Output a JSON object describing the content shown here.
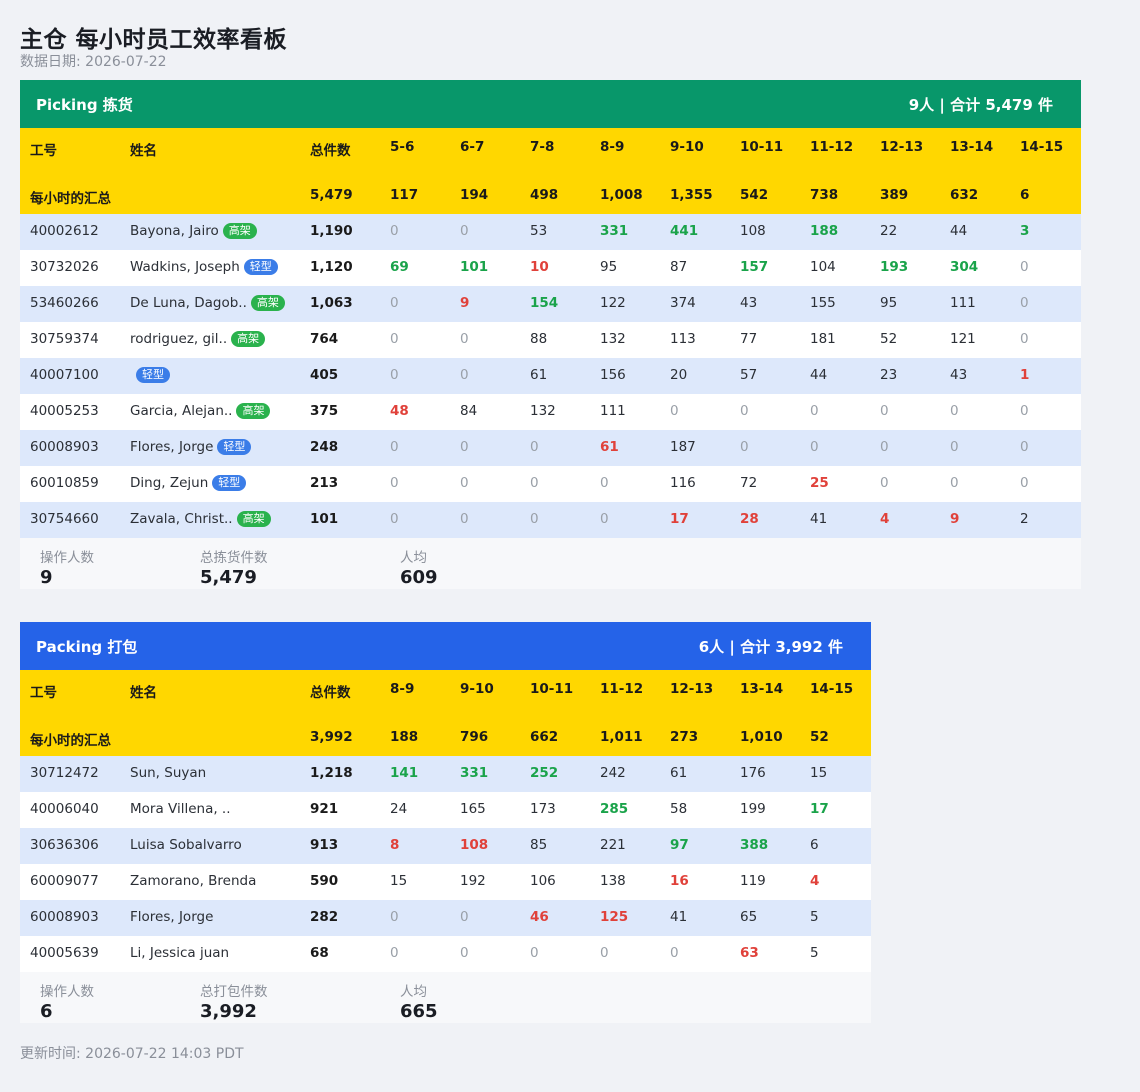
{
  "page": {
    "title": "主仓 每小时员工效率看板",
    "date_line": "数据日期: 2026-07-22",
    "footer": "更新时间: 2026-07-22 14:03 PDT"
  },
  "colors": {
    "picking_header": "#08976a",
    "packing_header": "#2563e8",
    "column_header_bg": "#ffd700",
    "high_value": "#1aa34a",
    "low_value": "#e0413a",
    "badge_gaojia": "#2ab24d",
    "badge_qingxing": "#3b7de8"
  },
  "sections": [
    {
      "key": "picking",
      "title": "Picking 拣货",
      "summary_right": "9人 | 合计 5,479 件",
      "columns": [
        "工号",
        "姓名",
        "总件数",
        "5-6",
        "6-7",
        "7-8",
        "8-9",
        "9-10",
        "10-11",
        "11-12",
        "12-13",
        "13-14",
        "14-15"
      ],
      "hourly_label": "每小时的汇总",
      "hourly_total": "5,479",
      "hourly": [
        "117",
        "194",
        "498",
        "1,008",
        "1,355",
        "542",
        "738",
        "389",
        "632",
        "6"
      ],
      "rows": [
        {
          "id": "40002612",
          "name": "Bayona, Jairo",
          "badge": "高架",
          "badge_type": "g",
          "total": "1,190",
          "values": [
            {
              "v": "0",
              "s": "zero"
            },
            {
              "v": "0",
              "s": "zero"
            },
            {
              "v": "53",
              "s": "norm"
            },
            {
              "v": "331",
              "s": "hi"
            },
            {
              "v": "441",
              "s": "hi"
            },
            {
              "v": "108",
              "s": "norm"
            },
            {
              "v": "188",
              "s": "hi"
            },
            {
              "v": "22",
              "s": "norm"
            },
            {
              "v": "44",
              "s": "norm"
            },
            {
              "v": "3",
              "s": "hi"
            }
          ]
        },
        {
          "id": "30732026",
          "name": "Wadkins, Joseph",
          "badge": "轻型",
          "badge_type": "b",
          "total": "1,120",
          "values": [
            {
              "v": "69",
              "s": "hi"
            },
            {
              "v": "101",
              "s": "hi"
            },
            {
              "v": "10",
              "s": "lo"
            },
            {
              "v": "95",
              "s": "norm"
            },
            {
              "v": "87",
              "s": "norm"
            },
            {
              "v": "157",
              "s": "hi"
            },
            {
              "v": "104",
              "s": "norm"
            },
            {
              "v": "193",
              "s": "hi"
            },
            {
              "v": "304",
              "s": "hi"
            },
            {
              "v": "0",
              "s": "zero"
            }
          ]
        },
        {
          "id": "53460266",
          "name": "De Luna, Dagob..",
          "badge": "高架",
          "badge_type": "g",
          "total": "1,063",
          "values": [
            {
              "v": "0",
              "s": "zero"
            },
            {
              "v": "9",
              "s": "lo"
            },
            {
              "v": "154",
              "s": "hi"
            },
            {
              "v": "122",
              "s": "norm"
            },
            {
              "v": "374",
              "s": "norm"
            },
            {
              "v": "43",
              "s": "norm"
            },
            {
              "v": "155",
              "s": "norm"
            },
            {
              "v": "95",
              "s": "norm"
            },
            {
              "v": "111",
              "s": "norm"
            },
            {
              "v": "0",
              "s": "zero"
            }
          ]
        },
        {
          "id": "30759374",
          "name": "rodriguez, gil..",
          "badge": "高架",
          "badge_type": "g",
          "total": "764",
          "values": [
            {
              "v": "0",
              "s": "zero"
            },
            {
              "v": "0",
              "s": "zero"
            },
            {
              "v": "88",
              "s": "norm"
            },
            {
              "v": "132",
              "s": "norm"
            },
            {
              "v": "113",
              "s": "norm"
            },
            {
              "v": "77",
              "s": "norm"
            },
            {
              "v": "181",
              "s": "norm"
            },
            {
              "v": "52",
              "s": "norm"
            },
            {
              "v": "121",
              "s": "norm"
            },
            {
              "v": "0",
              "s": "zero"
            }
          ]
        },
        {
          "id": "40007100",
          "name": "",
          "badge": "轻型",
          "badge_type": "b",
          "total": "405",
          "values": [
            {
              "v": "0",
              "s": "zero"
            },
            {
              "v": "0",
              "s": "zero"
            },
            {
              "v": "61",
              "s": "norm"
            },
            {
              "v": "156",
              "s": "norm"
            },
            {
              "v": "20",
              "s": "norm"
            },
            {
              "v": "57",
              "s": "norm"
            },
            {
              "v": "44",
              "s": "norm"
            },
            {
              "v": "23",
              "s": "norm"
            },
            {
              "v": "43",
              "s": "norm"
            },
            {
              "v": "1",
              "s": "lo"
            }
          ]
        },
        {
          "id": "40005253",
          "name": "Garcia, Alejan..",
          "badge": "高架",
          "badge_type": "g",
          "total": "375",
          "values": [
            {
              "v": "48",
              "s": "lo"
            },
            {
              "v": "84",
              "s": "norm"
            },
            {
              "v": "132",
              "s": "norm"
            },
            {
              "v": "111",
              "s": "norm"
            },
            {
              "v": "0",
              "s": "zero"
            },
            {
              "v": "0",
              "s": "zero"
            },
            {
              "v": "0",
              "s": "zero"
            },
            {
              "v": "0",
              "s": "zero"
            },
            {
              "v": "0",
              "s": "zero"
            },
            {
              "v": "0",
              "s": "zero"
            }
          ]
        },
        {
          "id": "60008903",
          "name": "Flores, Jorge",
          "badge": "轻型",
          "badge_type": "b",
          "total": "248",
          "values": [
            {
              "v": "0",
              "s": "zero"
            },
            {
              "v": "0",
              "s": "zero"
            },
            {
              "v": "0",
              "s": "zero"
            },
            {
              "v": "61",
              "s": "lo"
            },
            {
              "v": "187",
              "s": "norm"
            },
            {
              "v": "0",
              "s": "zero"
            },
            {
              "v": "0",
              "s": "zero"
            },
            {
              "v": "0",
              "s": "zero"
            },
            {
              "v": "0",
              "s": "zero"
            },
            {
              "v": "0",
              "s": "zero"
            }
          ]
        },
        {
          "id": "60010859",
          "name": "Ding, Zejun",
          "badge": "轻型",
          "badge_type": "b",
          "total": "213",
          "values": [
            {
              "v": "0",
              "s": "zero"
            },
            {
              "v": "0",
              "s": "zero"
            },
            {
              "v": "0",
              "s": "zero"
            },
            {
              "v": "0",
              "s": "zero"
            },
            {
              "v": "116",
              "s": "norm"
            },
            {
              "v": "72",
              "s": "norm"
            },
            {
              "v": "25",
              "s": "lo"
            },
            {
              "v": "0",
              "s": "zero"
            },
            {
              "v": "0",
              "s": "zero"
            },
            {
              "v": "0",
              "s": "zero"
            }
          ]
        },
        {
          "id": "30754660",
          "name": "Zavala, Christ..",
          "badge": "高架",
          "badge_type": "g",
          "total": "101",
          "values": [
            {
              "v": "0",
              "s": "zero"
            },
            {
              "v": "0",
              "s": "zero"
            },
            {
              "v": "0",
              "s": "zero"
            },
            {
              "v": "0",
              "s": "zero"
            },
            {
              "v": "17",
              "s": "lo"
            },
            {
              "v": "28",
              "s": "lo"
            },
            {
              "v": "41",
              "s": "norm"
            },
            {
              "v": "4",
              "s": "lo"
            },
            {
              "v": "9",
              "s": "lo"
            },
            {
              "v": "2",
              "s": "norm"
            }
          ]
        }
      ],
      "stats": [
        {
          "label": "操作人数",
          "value": "9"
        },
        {
          "label": "总拣货件数",
          "value": "5,479"
        },
        {
          "label": "人均",
          "value": "609"
        }
      ]
    },
    {
      "key": "packing",
      "title": "Packing 打包",
      "summary_right": "6人 | 合计 3,992 件",
      "columns": [
        "工号",
        "姓名",
        "总件数",
        "8-9",
        "9-10",
        "10-11",
        "11-12",
        "12-13",
        "13-14",
        "14-15"
      ],
      "hourly_label": "每小时的汇总",
      "hourly_total": "3,992",
      "hourly": [
        "188",
        "796",
        "662",
        "1,011",
        "273",
        "1,010",
        "52"
      ],
      "rows": [
        {
          "id": "30712472",
          "name": "Sun, Suyan",
          "badge": "",
          "badge_type": "",
          "total": "1,218",
          "values": [
            {
              "v": "141",
              "s": "hi"
            },
            {
              "v": "331",
              "s": "hi"
            },
            {
              "v": "252",
              "s": "hi"
            },
            {
              "v": "242",
              "s": "norm"
            },
            {
              "v": "61",
              "s": "norm"
            },
            {
              "v": "176",
              "s": "norm"
            },
            {
              "v": "15",
              "s": "norm"
            }
          ]
        },
        {
          "id": "40006040",
          "name": "Mora Villena, ..",
          "badge": "",
          "badge_type": "",
          "total": "921",
          "values": [
            {
              "v": "24",
              "s": "norm"
            },
            {
              "v": "165",
              "s": "norm"
            },
            {
              "v": "173",
              "s": "norm"
            },
            {
              "v": "285",
              "s": "hi"
            },
            {
              "v": "58",
              "s": "norm"
            },
            {
              "v": "199",
              "s": "norm"
            },
            {
              "v": "17",
              "s": "hi"
            }
          ]
        },
        {
          "id": "30636306",
          "name": "Luisa Sobalvarro",
          "badge": "",
          "badge_type": "",
          "total": "913",
          "values": [
            {
              "v": "8",
              "s": "lo"
            },
            {
              "v": "108",
              "s": "lo"
            },
            {
              "v": "85",
              "s": "norm"
            },
            {
              "v": "221",
              "s": "norm"
            },
            {
              "v": "97",
              "s": "hi"
            },
            {
              "v": "388",
              "s": "hi"
            },
            {
              "v": "6",
              "s": "norm"
            }
          ]
        },
        {
          "id": "60009077",
          "name": "Zamorano, Brenda",
          "badge": "",
          "badge_type": "",
          "total": "590",
          "values": [
            {
              "v": "15",
              "s": "norm"
            },
            {
              "v": "192",
              "s": "norm"
            },
            {
              "v": "106",
              "s": "norm"
            },
            {
              "v": "138",
              "s": "norm"
            },
            {
              "v": "16",
              "s": "lo"
            },
            {
              "v": "119",
              "s": "norm"
            },
            {
              "v": "4",
              "s": "lo"
            }
          ]
        },
        {
          "id": "60008903",
          "name": "Flores, Jorge",
          "badge": "",
          "badge_type": "",
          "total": "282",
          "values": [
            {
              "v": "0",
              "s": "zero"
            },
            {
              "v": "0",
              "s": "zero"
            },
            {
              "v": "46",
              "s": "lo"
            },
            {
              "v": "125",
              "s": "lo"
            },
            {
              "v": "41",
              "s": "norm"
            },
            {
              "v": "65",
              "s": "norm"
            },
            {
              "v": "5",
              "s": "norm"
            }
          ]
        },
        {
          "id": "40005639",
          "name": "Li, Jessica juan",
          "badge": "",
          "badge_type": "",
          "total": "68",
          "values": [
            {
              "v": "0",
              "s": "zero"
            },
            {
              "v": "0",
              "s": "zero"
            },
            {
              "v": "0",
              "s": "zero"
            },
            {
              "v": "0",
              "s": "zero"
            },
            {
              "v": "0",
              "s": "zero"
            },
            {
              "v": "63",
              "s": "lo"
            },
            {
              "v": "5",
              "s": "norm"
            }
          ]
        }
      ],
      "stats": [
        {
          "label": "操作人数",
          "value": "6"
        },
        {
          "label": "总打包件数",
          "value": "3,992"
        },
        {
          "label": "人均",
          "value": "665"
        }
      ]
    }
  ]
}
